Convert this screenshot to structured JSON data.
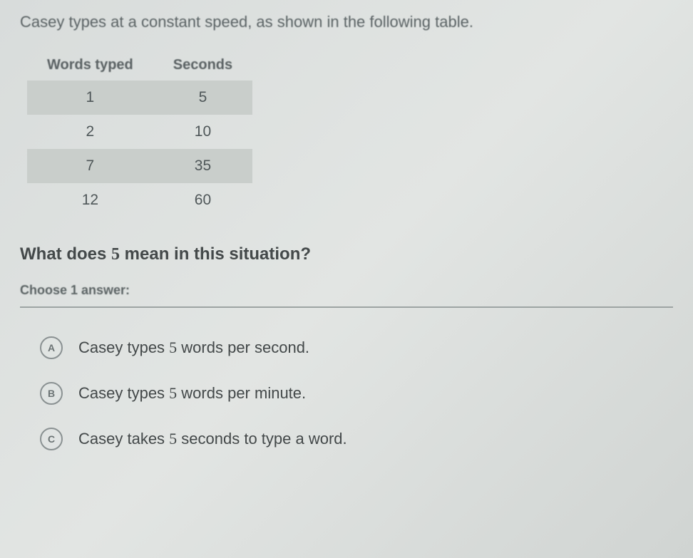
{
  "intro": "Casey types at a constant speed, as shown in the following table.",
  "table": {
    "headers": {
      "col1": "Words typed",
      "col2": "Seconds"
    },
    "rows": [
      {
        "words": "1",
        "seconds": "5"
      },
      {
        "words": "2",
        "seconds": "10"
      },
      {
        "words": "7",
        "seconds": "35"
      },
      {
        "words": "12",
        "seconds": "60"
      }
    ]
  },
  "question_prefix": "What does ",
  "question_value": "5",
  "question_suffix": " mean in this situation?",
  "choose_label": "Choose 1 answer:",
  "options": {
    "a": {
      "letter": "A",
      "prefix": "Casey types ",
      "num": "5",
      "suffix": " words per second."
    },
    "b": {
      "letter": "B",
      "prefix": "Casey types ",
      "num": "5",
      "suffix": " words per minute."
    },
    "c": {
      "letter": "C",
      "prefix": "Casey takes ",
      "num": "5",
      "suffix": " seconds to type a word."
    }
  }
}
